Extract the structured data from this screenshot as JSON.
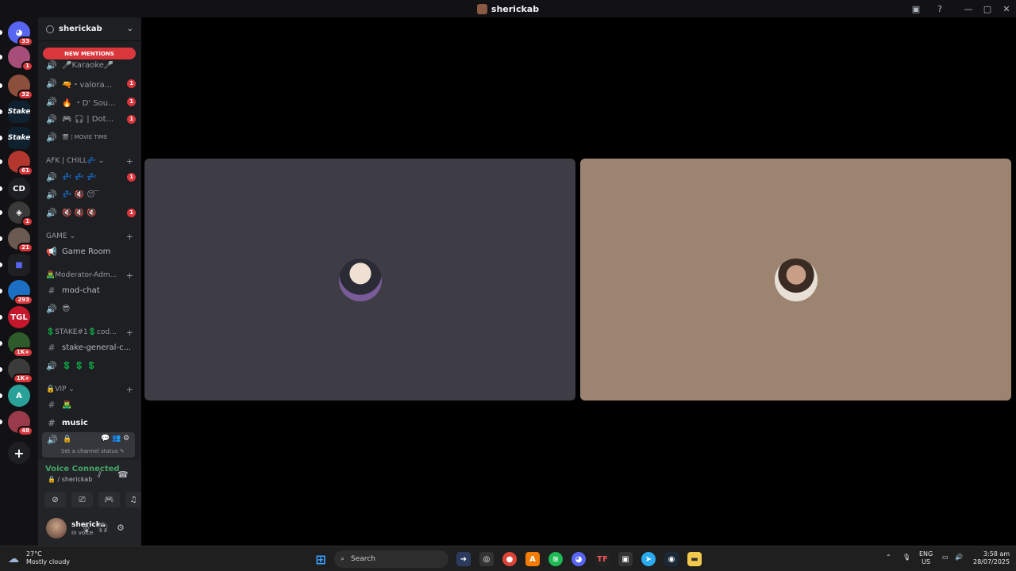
{
  "window": {
    "title": "sherickab",
    "minimize": "—",
    "maximize": "▢",
    "close": "✕"
  },
  "servers": [
    {
      "name": "discord-home",
      "glyph": "◕",
      "badge": "33",
      "color": "#5865f2"
    },
    {
      "name": "server-1",
      "glyph": "",
      "badge": "1",
      "color": "#a64d79"
    },
    {
      "name": "server-2",
      "glyph": "",
      "badge": "32",
      "color": "#8c4f3c"
    },
    {
      "name": "stake-1",
      "glyph": "Stake",
      "badge": "",
      "color": "#0f212e"
    },
    {
      "name": "stake-2",
      "glyph": "Stake",
      "badge": "",
      "color": "#0f212e"
    },
    {
      "name": "server-3",
      "glyph": "",
      "badge": "61",
      "color": "#b3362f"
    },
    {
      "name": "server-cd",
      "glyph": "CD",
      "badge": "",
      "color": "#1e1f22"
    },
    {
      "name": "server-4",
      "glyph": "◈",
      "badge": "1",
      "color": "#3a3a3a"
    },
    {
      "name": "server-5",
      "glyph": "",
      "badge": "21",
      "color": "#6b5a52"
    },
    {
      "name": "folder",
      "glyph": "■",
      "badge": "",
      "color": "#1e1f22"
    },
    {
      "name": "server-6",
      "glyph": "",
      "badge": "293",
      "color": "#1c6fc2"
    },
    {
      "name": "server-7",
      "glyph": "TGL",
      "badge": "",
      "color": "#c4172c"
    },
    {
      "name": "server-8",
      "glyph": "",
      "badge": "1K+",
      "color": "#2f5b2a"
    },
    {
      "name": "server-9",
      "glyph": "",
      "badge": "1K+",
      "color": "#3b3b3b"
    },
    {
      "name": "server-10",
      "glyph": "A",
      "badge": "",
      "color": "#2aa198"
    },
    {
      "name": "server-11",
      "glyph": "",
      "badge": "48",
      "color": "#9a3b4b"
    }
  ],
  "add_server": "+",
  "guild": {
    "name": "sherickab",
    "new_mentions": "NEW MENTIONS"
  },
  "channels": {
    "voice_top": [
      {
        "label": "🎤Karaoke🎤",
        "count": ""
      },
      {
        "label": "🔫・valora...",
        "count": "1"
      },
      {
        "label": "🔥 ・D' Sou...",
        "count": "1"
      },
      {
        "label": "🎮 🎧 | Dot...",
        "count": "1"
      },
      {
        "label": "🎬 ¦ MOVIE TIME",
        "count": ""
      }
    ],
    "cat_afk": "AFK | CHILL💤 ⌄",
    "afk": [
      {
        "label": "💤 💤 💤",
        "count": "1"
      },
      {
        "label": "💤 🔇 😴",
        "count": ""
      },
      {
        "label": "🔇 🔇 🔇",
        "count": "1"
      }
    ],
    "cat_game": "GAME ⌄",
    "game_room": "Game Room",
    "cat_mod": "🧟‍♂️Moderator-Adm...",
    "mod_chat": "mod-chat",
    "mod_voice": "😎",
    "cat_stake": "💲STAKE#1💲cod...",
    "stake_chat": "stake-general-c...",
    "stake_voice": "💲 💲 💲",
    "cat_vip": "🔒VIP ⌄",
    "vip_1": "🧟‍♂️",
    "music": "music",
    "active_voice": "🔒",
    "channel_status": "Set a channel status ✎"
  },
  "voice": {
    "title": "Voice Connected",
    "subtitle": "🔒 / sherickab"
  },
  "user": {
    "name": "shericka",
    "status": "In voice"
  },
  "taskbar": {
    "weather_temp": "27°C",
    "weather_desc": "Mostly cloudy",
    "search": "Search",
    "lang": "ENG",
    "region": "US",
    "time": "3:58 am",
    "date": "28/07/2025"
  },
  "colors": {
    "tile_left": "#3e3d46",
    "tile_right": "#9c8471",
    "mention_red": "#da373c",
    "voice_green": "#45a366"
  }
}
